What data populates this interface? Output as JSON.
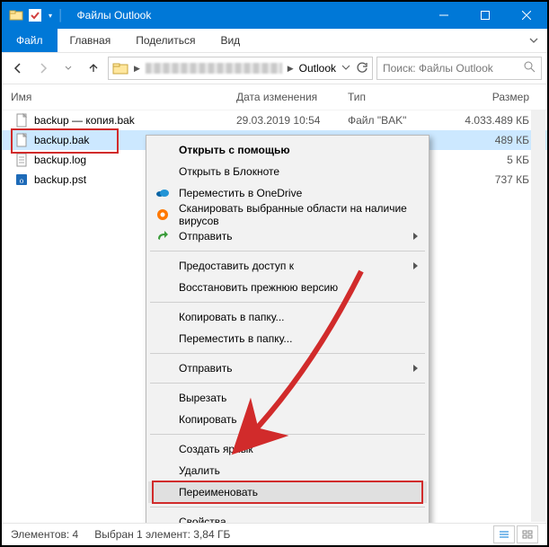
{
  "window": {
    "title": "Файлы Outlook"
  },
  "ribbon": {
    "file": "Файл",
    "tabs": [
      "Главная",
      "Поделиться",
      "Вид"
    ]
  },
  "address": {
    "crumb": "Outlook"
  },
  "search": {
    "placeholder": "Поиск: Файлы Outlook"
  },
  "columns": {
    "name": "Имя",
    "date": "Дата изменения",
    "type": "Тип",
    "size": "Размер"
  },
  "files": [
    {
      "name": "backup — копия.bak",
      "date": "29.03.2019 10:54",
      "type": "Файл \"BAK\"",
      "size": "4.033.489 КБ"
    },
    {
      "name": "backup.bak",
      "date": "",
      "type": "",
      "size": "489 КБ"
    },
    {
      "name": "backup.log",
      "date": "",
      "type": "",
      "size": "5 КБ"
    },
    {
      "name": "backup.pst",
      "date": "",
      "type": "",
      "size": "737 КБ"
    }
  ],
  "context_menu": {
    "open_with": "Открыть с помощью",
    "open_notepad": "Открыть в Блокноте",
    "onedrive": "Переместить в OneDrive",
    "scan": "Сканировать выбранные области на наличие вирусов",
    "send_to": "Отправить",
    "share": "Предоставить доступ к",
    "restore": "Восстановить прежнюю версию",
    "copy_to": "Копировать в папку...",
    "move_to": "Переместить в папку...",
    "send": "Отправить",
    "cut": "Вырезать",
    "copy": "Копировать",
    "shortcut": "Создать ярлык",
    "delete": "Удалить",
    "rename": "Переименовать",
    "properties": "Свойства"
  },
  "status": {
    "count": "Элементов: 4",
    "selection": "Выбран 1 элемент: 3,84 ГБ"
  }
}
